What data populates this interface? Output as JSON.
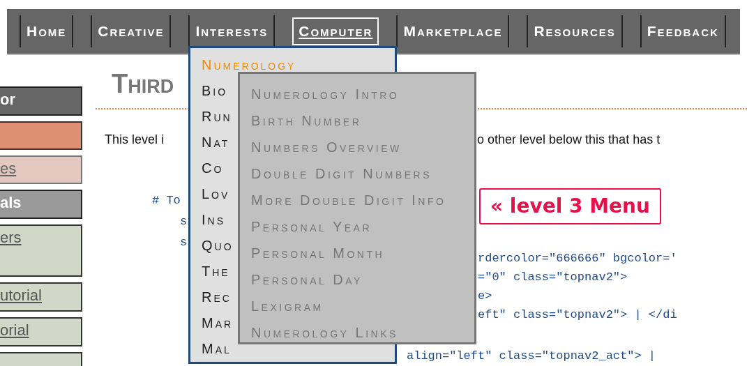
{
  "nav": [
    {
      "label": "Home",
      "selected": false
    },
    {
      "label": "Creative",
      "selected": false
    },
    {
      "label": "Interests",
      "selected": false
    },
    {
      "label": "Computer",
      "selected": true
    },
    {
      "label": "Marketplace",
      "selected": false
    },
    {
      "label": "Resources",
      "selected": false
    },
    {
      "label": "Feedback",
      "selected": false
    }
  ],
  "sidebar": [
    {
      "kind": "header",
      "label": "or"
    },
    {
      "kind": "active"
    },
    {
      "kind": "visited",
      "label": "es"
    },
    {
      "kind": "section",
      "label": "als"
    },
    {
      "kind": "tall",
      "label": "ers"
    },
    {
      "kind": "link",
      "label": "utorial"
    },
    {
      "kind": "link",
      "label": "orial"
    },
    {
      "kind": "link"
    }
  ],
  "heading": "Third",
  "intro_fragments": [
    "This level i",
    "o other level below this that has t"
  ],
  "code_left": [
    "# To",
    "s",
    "s"
  ],
  "level_badge": "« level 3 Menu",
  "code_right": [
    {
      "kind": "after-menu",
      "text": "rdercolor=\"666666\" bgcolor='"
    },
    {
      "kind": "after-menu",
      "text": "=\"0\" class=\"topnav2\">"
    },
    {
      "kind": "after-menu",
      "text": "e>"
    },
    {
      "kind": "after-menu",
      "text": "eft\" class=\"topnav2\"> | </di"
    },
    {
      "kind": "full",
      "text": "align=\"left\" class=\"topnav2_act\"> |"
    }
  ],
  "dropdown": {
    "items": [
      {
        "label": "Numerology",
        "selected": true
      },
      {
        "label": "Bio",
        "selected": false
      },
      {
        "label": "Run",
        "selected": false
      },
      {
        "label": "Nat",
        "selected": false
      },
      {
        "label": "Co",
        "selected": false
      },
      {
        "label": "Lov",
        "selected": false
      },
      {
        "label": "Ins",
        "selected": false
      },
      {
        "label": "Quo",
        "selected": false
      },
      {
        "label": "The",
        "selected": false
      },
      {
        "label": "Rec",
        "selected": false
      },
      {
        "label": "Mar",
        "selected": false
      },
      {
        "label": "Mal",
        "selected": false
      }
    ]
  },
  "submenu": {
    "items": [
      {
        "label": "Numerology Intro"
      },
      {
        "label": "Birth Number"
      },
      {
        "label": "Numbers Overview"
      },
      {
        "label": "Double Digit Numbers"
      },
      {
        "label": "More Double Digit Info"
      },
      {
        "label": "Personal Year"
      },
      {
        "label": "Personal Month"
      },
      {
        "label": "Personal Day"
      },
      {
        "label": "Lexigram"
      },
      {
        "label": "Numerology Links"
      }
    ]
  }
}
